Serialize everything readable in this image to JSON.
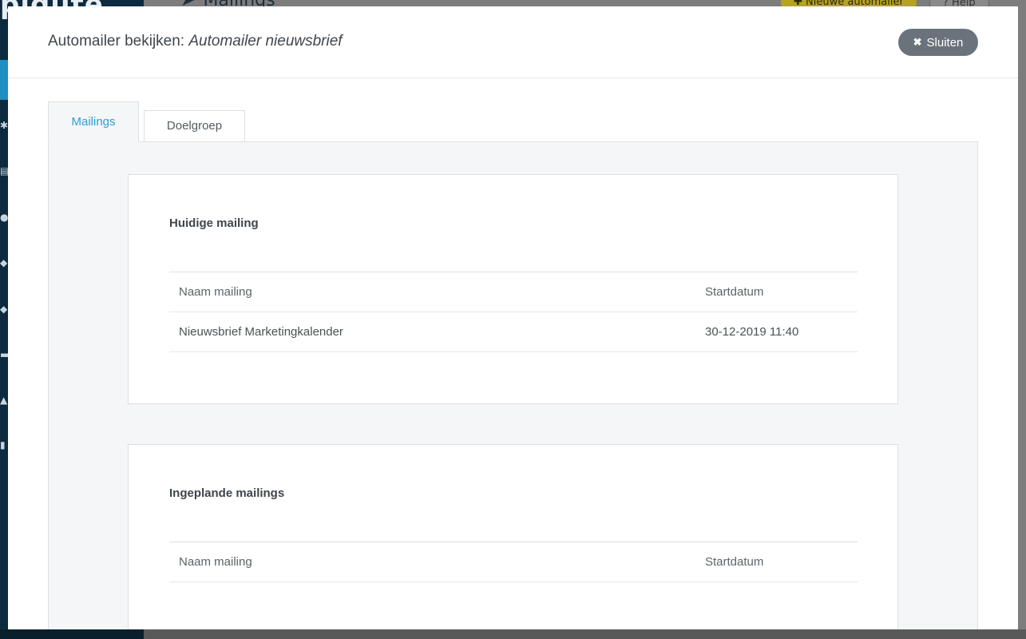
{
  "background": {
    "logo_text": "piqute",
    "page_title": "Mailings",
    "new_button_label": "Nieuwe automailer",
    "help_button_label": "Help"
  },
  "modal": {
    "title_prefix": "Automailer bekijken:",
    "title_name": "Automailer nieuwsbrief",
    "close_label": "Sluiten",
    "close_icon": "times-icon",
    "tabs": [
      {
        "label": "Mailings",
        "active": true
      },
      {
        "label": "Doelgroep",
        "active": false
      }
    ],
    "current_section": {
      "title": "Huidige mailing",
      "columns": [
        "Naam mailing",
        "Startdatum"
      ],
      "rows": [
        {
          "name": "Nieuwsbrief Marketingkalender",
          "start": "30-12-2019 11:40"
        }
      ]
    },
    "planned_section": {
      "title": "Ingeplande mailings",
      "columns": [
        "Naam mailing",
        "Startdatum"
      ],
      "rows": []
    }
  },
  "colors": {
    "accent": "#2f9fd0",
    "close_button": "#6a737b",
    "sidebar": "#0c2b3f"
  }
}
